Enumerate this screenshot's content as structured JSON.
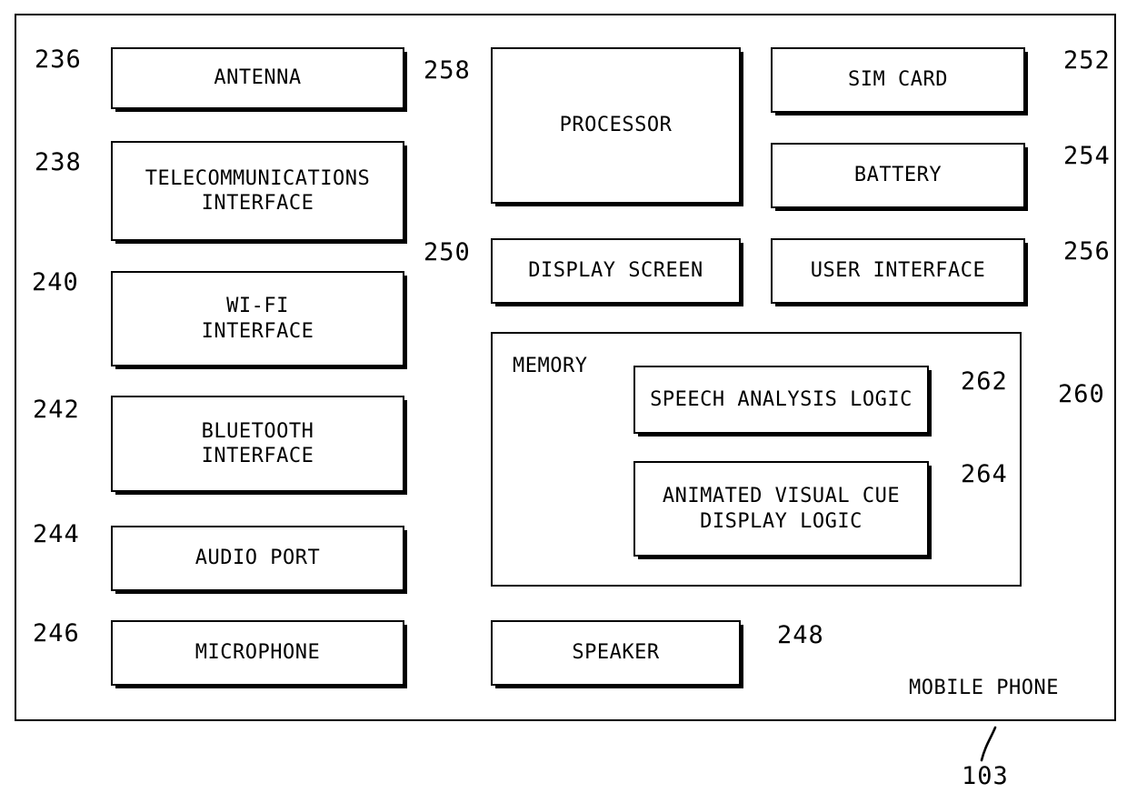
{
  "figure": {
    "enclosure_label": "MOBILE PHONE",
    "enclosure_ref": "103"
  },
  "left_column": [
    {
      "ref": "236",
      "label": "ANTENNA"
    },
    {
      "ref": "238",
      "label": "TELECOMMUNICATIONS\nINTERFACE"
    },
    {
      "ref": "240",
      "label": "WI-FI\nINTERFACE"
    },
    {
      "ref": "242",
      "label": "BLUETOOTH\nINTERFACE"
    },
    {
      "ref": "244",
      "label": "AUDIO PORT"
    },
    {
      "ref": "246",
      "label": "MICROPHONE"
    }
  ],
  "middle_column": [
    {
      "ref": "258",
      "label": "PROCESSOR"
    },
    {
      "ref": "250",
      "label": "DISPLAY SCREEN"
    },
    {
      "ref": "248",
      "label": "SPEAKER"
    }
  ],
  "right_column": [
    {
      "ref": "252",
      "label": "SIM CARD"
    },
    {
      "ref": "254",
      "label": "BATTERY"
    },
    {
      "ref": "256",
      "label": "USER INTERFACE"
    }
  ],
  "memory": {
    "ref": "260",
    "label": "MEMORY",
    "modules": [
      {
        "ref": "262",
        "label": "SPEECH ANALYSIS LOGIC"
      },
      {
        "ref": "264",
        "label": "ANIMATED VISUAL CUE\nDISPLAY LOGIC"
      }
    ]
  },
  "colors": {
    "ink": "#000000",
    "paper": "#ffffff"
  }
}
